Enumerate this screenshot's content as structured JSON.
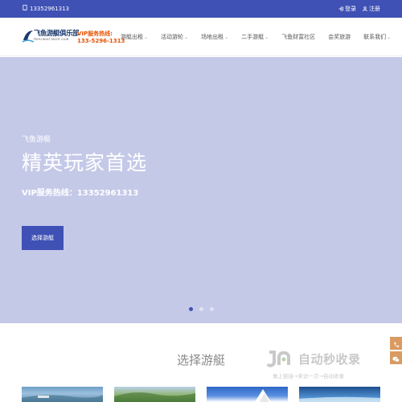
{
  "topbar": {
    "phone": "13352961313",
    "login_label": "登录",
    "register_label": "注册"
  },
  "header": {
    "logo_brand": "飞鱼游艇俱乐部",
    "logo_sub": "FEIYU BOAT YACHT CLUB",
    "hotline_label": "VIP服务热线:",
    "hotline_number": "133-5296-1313"
  },
  "nav": {
    "items": [
      {
        "label": "游艇出租",
        "has_dropdown": true
      },
      {
        "label": "活动游轮",
        "has_dropdown": true
      },
      {
        "label": "场地出租",
        "has_dropdown": true
      },
      {
        "label": "二手游艇",
        "has_dropdown": true
      },
      {
        "label": "飞鱼财富社区",
        "has_dropdown": false
      },
      {
        "label": "会奖旅游",
        "has_dropdown": false
      },
      {
        "label": "联系我们",
        "has_dropdown": true
      }
    ]
  },
  "hero": {
    "eyebrow": "飞鱼游艇",
    "headline": "精英玩家首选",
    "vip_text": "VIP服务热线：13352961313",
    "cta_label": "选择游艇",
    "slides_total": 3,
    "active_slide": 1
  },
  "section": {
    "title": "选择游艇"
  },
  "watermark": {
    "title": "自动秒收录",
    "subtitle": "做上链接→来访一次→自动收录"
  },
  "colors": {
    "primary": "#3f51b5",
    "hero_bg": "#c5c9e8",
    "hotline": "#e65100",
    "side_tool": "#d99b62"
  },
  "icons": [
    "phone-icon",
    "login-icon",
    "user-icon",
    "chevron-down-icon",
    "phone-side-icon",
    "wechat-icon"
  ]
}
